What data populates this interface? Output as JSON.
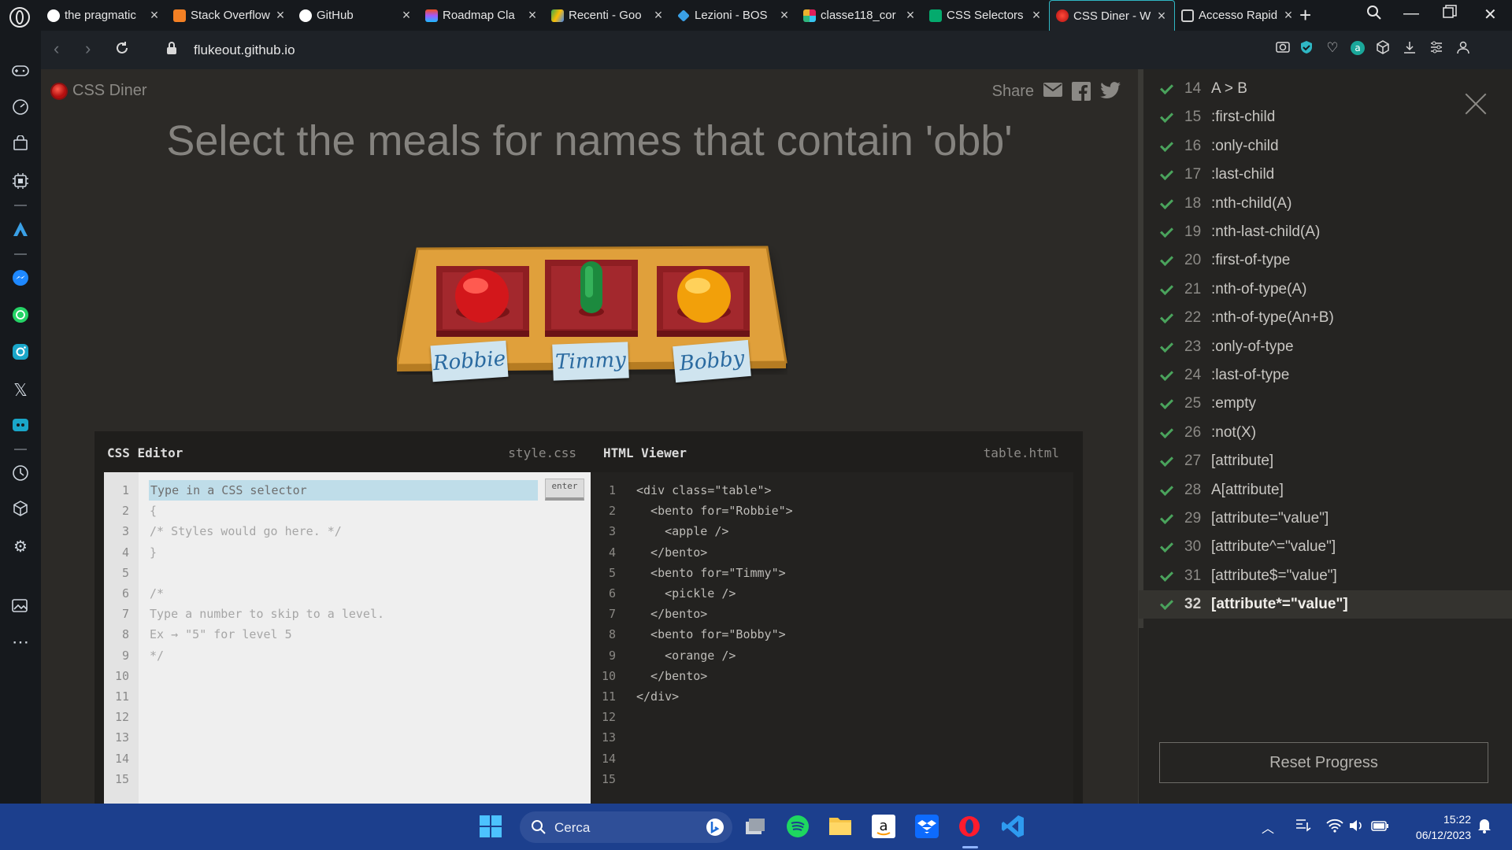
{
  "browser": {
    "tabs": [
      {
        "label": "the pragmatic",
        "icon": "google-icon",
        "color": "#4285f4"
      },
      {
        "label": "Stack Overflow",
        "icon": "stackoverflow-icon",
        "color": "#f48024"
      },
      {
        "label": "GitHub",
        "icon": "github-icon",
        "color": "#ffffff"
      },
      {
        "label": "Roadmap Cla",
        "icon": "figma-icon",
        "color": "#f24e1e"
      },
      {
        "label": "Recenti - Goo",
        "icon": "google-drive-icon",
        "color": "#34a853"
      },
      {
        "label": "Lezioni - BOS",
        "icon": "bos-icon",
        "color": "#3aa0e6"
      },
      {
        "label": "classe118_cor",
        "icon": "slack-icon",
        "color": "#e01e5a"
      },
      {
        "label": "CSS Selectors",
        "icon": "w3schools-icon",
        "color": "#04aa6d"
      },
      {
        "label": "CSS Diner - W",
        "icon": "css-diner-icon",
        "color": "#d33",
        "active": true
      },
      {
        "label": "Accesso Rapid",
        "icon": "speed-dial-icon",
        "color": "#cfcfcf"
      }
    ],
    "url": "flukeout.github.io"
  },
  "page": {
    "logo": "CSS Diner",
    "share_label": "Share",
    "title": "Select the meals for names that contain 'obb'",
    "tags": [
      "Robbie",
      "Timmy",
      "Bobby"
    ]
  },
  "editor": {
    "css_title": "CSS Editor",
    "css_file": "style.css",
    "html_title": "HTML Viewer",
    "html_file": "table.html",
    "placeholder": "Type in a CSS selector",
    "enter_label": "enter",
    "css_lines": [
      "",
      "{",
      "/* Styles would go here. */",
      "}",
      "",
      "/*",
      "Type a number to skip to a level.",
      "Ex → \"5\" for level 5",
      "*/",
      "",
      "",
      "",
      "",
      "",
      ""
    ],
    "html_lines": [
      "<div class=\"table\">",
      "  <bento for=\"Robbie\">",
      "    <apple />",
      "  </bento>",
      "  <bento for=\"Timmy\">",
      "    <pickle />",
      "  </bento>",
      "  <bento for=\"Bobby\">",
      "    <orange />",
      "  </bento>",
      "</div>",
      "",
      "",
      "",
      ""
    ],
    "line_numbers": [
      "1",
      "2",
      "3",
      "4",
      "5",
      "6",
      "7",
      "8",
      "9",
      "10",
      "11",
      "12",
      "13",
      "14",
      "15"
    ]
  },
  "levels": {
    "items": [
      {
        "num": "14",
        "label": "A > B"
      },
      {
        "num": "15",
        "label": ":first-child"
      },
      {
        "num": "16",
        "label": ":only-child"
      },
      {
        "num": "17",
        "label": ":last-child"
      },
      {
        "num": "18",
        "label": ":nth-child(A)"
      },
      {
        "num": "19",
        "label": ":nth-last-child(A)"
      },
      {
        "num": "20",
        "label": ":first-of-type"
      },
      {
        "num": "21",
        "label": ":nth-of-type(A)"
      },
      {
        "num": "22",
        "label": ":nth-of-type(An+B)"
      },
      {
        "num": "23",
        "label": ":only-of-type"
      },
      {
        "num": "24",
        "label": ":last-of-type"
      },
      {
        "num": "25",
        "label": ":empty"
      },
      {
        "num": "26",
        "label": ":not(X)"
      },
      {
        "num": "27",
        "label": "[attribute]"
      },
      {
        "num": "28",
        "label": "A[attribute]"
      },
      {
        "num": "29",
        "label": "[attribute=\"value\"]"
      },
      {
        "num": "30",
        "label": "[attribute^=\"value\"]"
      },
      {
        "num": "31",
        "label": "[attribute$=\"value\"]"
      },
      {
        "num": "32",
        "label": "[attribute*=\"value\"]",
        "current": true
      }
    ],
    "reset_label": "Reset Progress"
  },
  "taskbar": {
    "search_label": "Cerca",
    "time": "15:22",
    "date": "06/12/2023"
  }
}
